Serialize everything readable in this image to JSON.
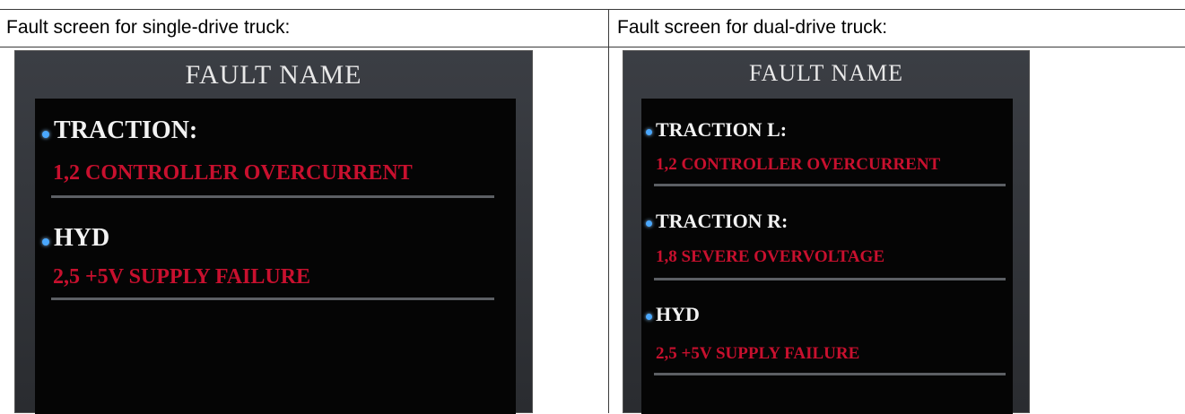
{
  "captions": {
    "single": "Fault screen for single-drive truck:",
    "dual": "Fault screen for dual-drive truck:"
  },
  "single_screen": {
    "title": "FAULT NAME",
    "faults": [
      {
        "label": "TRACTION:",
        "message": "1,2 CONTROLLER OVERCURRENT"
      },
      {
        "label": "HYD",
        "message": "2,5 +5V SUPPLY FAILURE"
      }
    ]
  },
  "dual_screen": {
    "title": "FAULT NAME",
    "faults": [
      {
        "label": "TRACTION L:",
        "message": "1,2 CONTROLLER OVERCURRENT"
      },
      {
        "label": "TRACTION R:",
        "message": "1,8 SEVERE OVERVOLTAGE"
      },
      {
        "label": "HYD",
        "message": "2,5 +5V SUPPLY FAILURE"
      }
    ]
  },
  "colors": {
    "bullet": "#4aa8ff",
    "fault_message": "#c8102e",
    "fault_label": "#f2f2f2",
    "panel": "#050505"
  }
}
